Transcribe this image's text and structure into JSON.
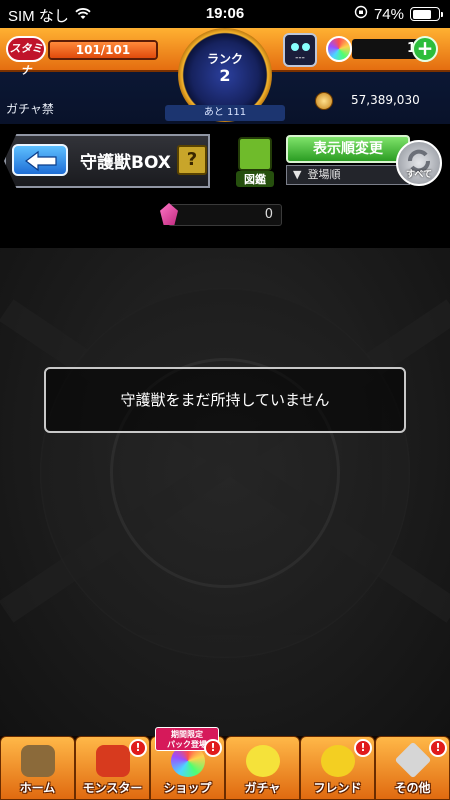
{
  "status_bar": {
    "carrier": "SIM なし",
    "time": "19:06",
    "battery": "74%",
    "battery_level": 0.74
  },
  "header": {
    "stamina_label": "スタミナ",
    "stamina_value": "101/101",
    "stamina_fill": 1.0,
    "rank_label": "ランク",
    "rank_value": "2",
    "robot_value": "---",
    "orb_count": "1",
    "gacha_ban": "ガチャ禁",
    "next_rank": "あと 111",
    "coins": "57,389,030"
  },
  "titlebar": {
    "title": "守護獣BOX",
    "help": "?",
    "zukan_label": "図鑑",
    "sort_button": "表示順変更",
    "sort_mode": "登場順",
    "all_label": "すべて"
  },
  "count": {
    "value": "0"
  },
  "main": {
    "empty_message": "守護獣をまだ所持していません"
  },
  "bottom_nav": {
    "items": [
      {
        "label": "ホーム",
        "icon": "home-icon",
        "badge": ""
      },
      {
        "label": "モンスター",
        "icon": "monster-icon",
        "badge": "!"
      },
      {
        "label": "ショップ",
        "icon": "shop-icon",
        "badge": "!",
        "tag": "期間限定\nパック登場"
      },
      {
        "label": "ガチャ",
        "icon": "gacha-icon",
        "badge": ""
      },
      {
        "label": "フレンド",
        "icon": "friend-icon",
        "badge": "!"
      },
      {
        "label": "その他",
        "icon": "other-icon",
        "badge": "!"
      }
    ]
  },
  "colors": {
    "accent_orange": "#e46d10",
    "sort_green": "#2b9d23",
    "back_blue": "#1f6ed6",
    "badge_red": "#e01b1b"
  }
}
